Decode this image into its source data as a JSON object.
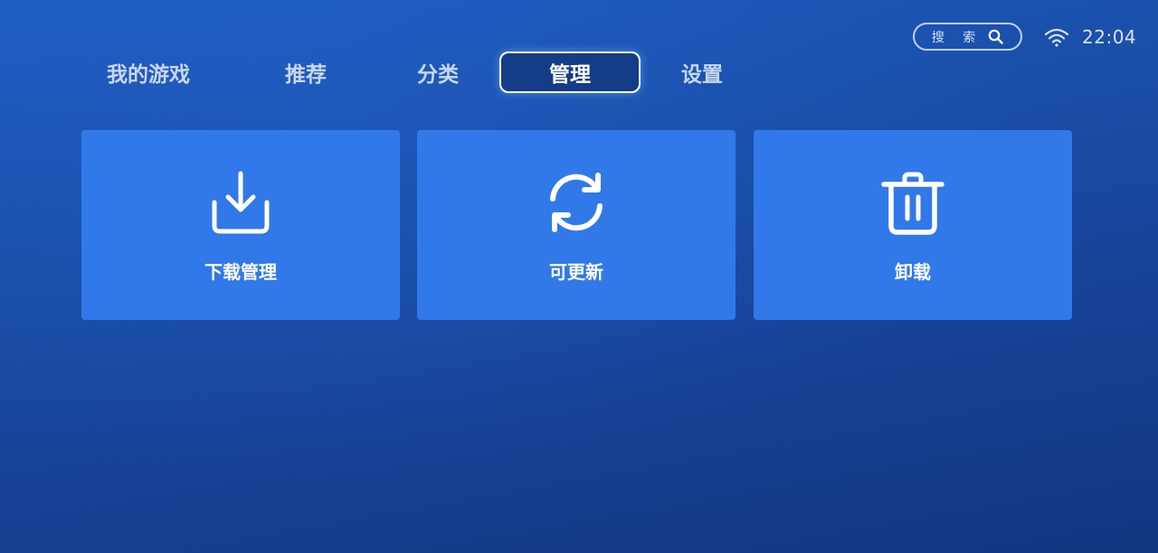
{
  "header": {
    "search": {
      "label": "搜 索",
      "icon": "search-icon"
    },
    "wifi_icon": "wifi-icon",
    "time": "22:04"
  },
  "tabs": [
    {
      "label": "我的游戏",
      "active": false
    },
    {
      "label": "推荐",
      "active": false
    },
    {
      "label": "分类",
      "active": false
    },
    {
      "label": "管理",
      "active": true
    },
    {
      "label": "设置",
      "active": false
    }
  ],
  "cards": [
    {
      "label": "下载管理",
      "icon": "download-icon"
    },
    {
      "label": "可更新",
      "icon": "refresh-icon"
    },
    {
      "label": "卸载",
      "icon": "trash-icon"
    }
  ],
  "colors": {
    "background": "#1a4ea8",
    "card": "#3179e9",
    "active_tab_bg": "#153c86",
    "text": "#ffffff"
  }
}
